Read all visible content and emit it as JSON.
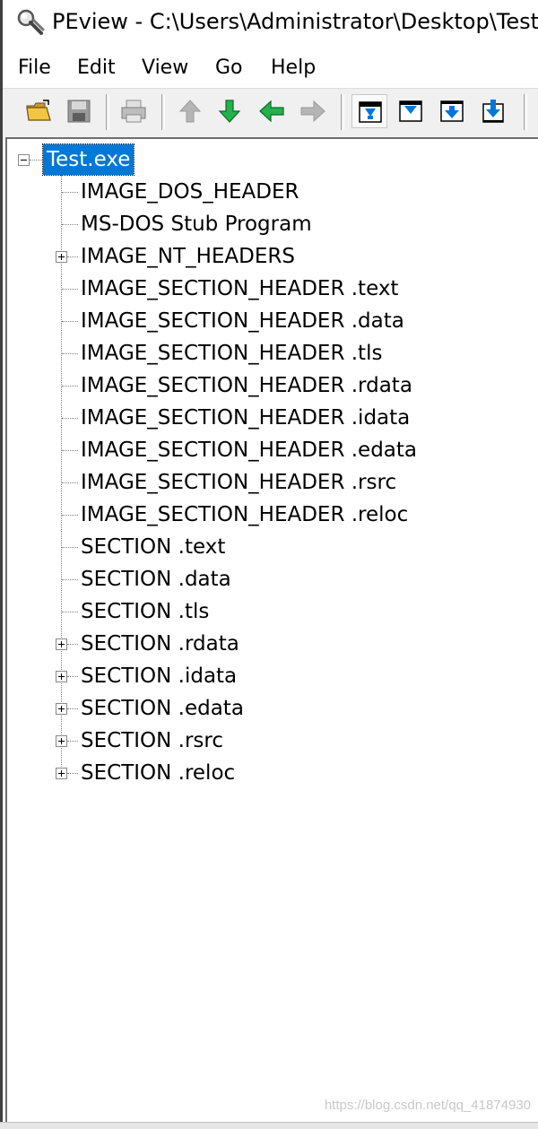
{
  "window": {
    "title": "PEview - C:\\Users\\Administrator\\Desktop\\Test.e",
    "app_icon": "magnifier-icon"
  },
  "menu": {
    "items": [
      "File",
      "Edit",
      "View",
      "Go",
      "Help"
    ]
  },
  "toolbar": {
    "buttons": [
      {
        "icon": "open-folder-icon"
      },
      {
        "icon": "save-icon"
      },
      {
        "icon": "print-icon"
      },
      {
        "icon": "arrow-up-icon"
      },
      {
        "icon": "arrow-down-icon"
      },
      {
        "icon": "arrow-left-icon"
      },
      {
        "icon": "arrow-right-icon"
      },
      {
        "icon": "view-byte-icon"
      },
      {
        "icon": "view-word-icon"
      },
      {
        "icon": "view-dword-icon"
      },
      {
        "icon": "view-qword-icon"
      }
    ],
    "accent_green": "#22b14c",
    "accent_blue": "#0078d7"
  },
  "tree": {
    "root": "Test.exe",
    "selection_color": "#0078d7",
    "items": [
      {
        "label": "IMAGE_DOS_HEADER",
        "expandable": false
      },
      {
        "label": "MS-DOS Stub Program",
        "expandable": false
      },
      {
        "label": "IMAGE_NT_HEADERS",
        "expandable": true
      },
      {
        "label": "IMAGE_SECTION_HEADER .text",
        "expandable": false
      },
      {
        "label": "IMAGE_SECTION_HEADER .data",
        "expandable": false
      },
      {
        "label": "IMAGE_SECTION_HEADER .tls",
        "expandable": false
      },
      {
        "label": "IMAGE_SECTION_HEADER .rdata",
        "expandable": false
      },
      {
        "label": "IMAGE_SECTION_HEADER .idata",
        "expandable": false
      },
      {
        "label": "IMAGE_SECTION_HEADER .edata",
        "expandable": false
      },
      {
        "label": "IMAGE_SECTION_HEADER .rsrc",
        "expandable": false
      },
      {
        "label": "IMAGE_SECTION_HEADER .reloc",
        "expandable": false
      },
      {
        "label": "SECTION .text",
        "expandable": false
      },
      {
        "label": "SECTION .data",
        "expandable": false
      },
      {
        "label": "SECTION .tls",
        "expandable": false
      },
      {
        "label": "SECTION .rdata",
        "expandable": true
      },
      {
        "label": "SECTION .idata",
        "expandable": true
      },
      {
        "label": "SECTION .edata",
        "expandable": true
      },
      {
        "label": "SECTION .rsrc",
        "expandable": true
      },
      {
        "label": "SECTION .reloc",
        "expandable": true
      }
    ]
  },
  "watermark": "https://blog.csdn.net/qq_41874930"
}
